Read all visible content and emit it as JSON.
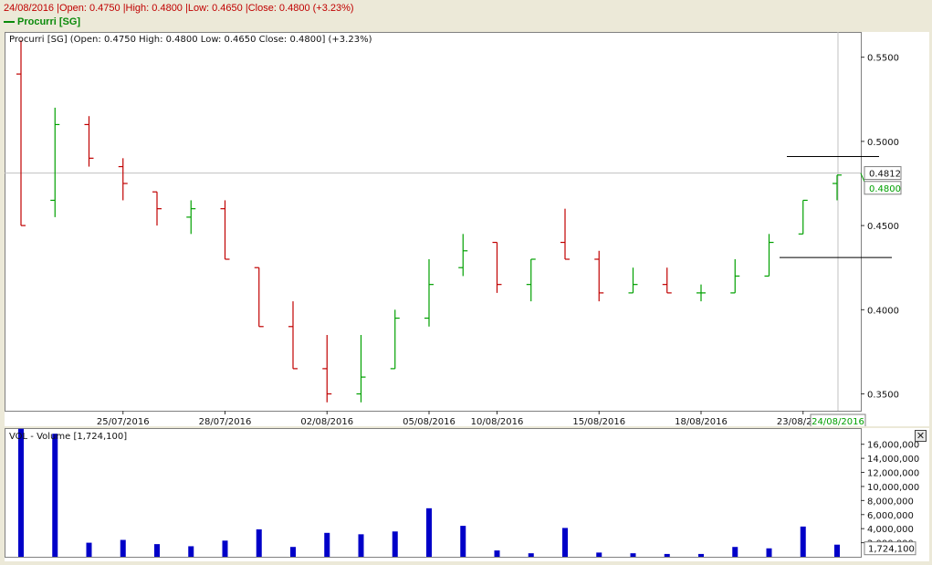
{
  "header": {
    "info_text": "24/08/2016 |Open: 0.4750 |High: 0.4800 |Low: 0.4650 |Close: 0.4800 (+3.23%)",
    "symbol_legend": "Procurri [SG]"
  },
  "price_panel": {
    "label": "Procurri [SG] (Open: 0.4750  High: 0.4800  Low: 0.4650  Close: 0.4800] (+3.23%)",
    "crosshair_price_label": "0.4812",
    "last_close_label": "0.4800",
    "crosshair_date_label": "24/08/2016"
  },
  "volume_panel": {
    "label": "VOL - Volume [1,724,100]",
    "last_volume_label": "1,724,100",
    "close_symbol": "✕"
  },
  "colors": {
    "up": "#00a000",
    "down": "#c00000",
    "volume": "#0000c8",
    "gridline": "#c0c0c0",
    "reference_line": "#000000"
  },
  "chart_data": [
    {
      "type": "ohlc",
      "title": "Procurri [SG]",
      "ylim": [
        0.34,
        0.565
      ],
      "y_ticks": [
        "0.5500",
        "0.5000",
        "0.4500",
        "0.4000",
        "0.3500"
      ],
      "x_tick_labels": [
        {
          "index": 3,
          "label": "25/07/2016"
        },
        {
          "index": 6,
          "label": "28/07/2016"
        },
        {
          "index": 9,
          "label": "02/08/2016"
        },
        {
          "index": 12,
          "label": "05/08/2016"
        },
        {
          "index": 14,
          "label": "10/08/2016"
        },
        {
          "index": 17,
          "label": "15/08/2016"
        },
        {
          "index": 20,
          "label": "18/08/2016"
        },
        {
          "index": 23,
          "label": "23/08/2016"
        }
      ],
      "bars": [
        {
          "o": 0.54,
          "h": 0.56,
          "l": 0.45,
          "c": 0.45
        },
        {
          "o": 0.465,
          "h": 0.52,
          "l": 0.455,
          "c": 0.51
        },
        {
          "o": 0.51,
          "h": 0.515,
          "l": 0.485,
          "c": 0.49
        },
        {
          "o": 0.485,
          "h": 0.49,
          "l": 0.465,
          "c": 0.475
        },
        {
          "o": 0.47,
          "h": 0.47,
          "l": 0.45,
          "c": 0.46
        },
        {
          "o": 0.455,
          "h": 0.465,
          "l": 0.445,
          "c": 0.46
        },
        {
          "o": 0.46,
          "h": 0.465,
          "l": 0.43,
          "c": 0.43
        },
        {
          "o": 0.425,
          "h": 0.425,
          "l": 0.39,
          "c": 0.39
        },
        {
          "o": 0.39,
          "h": 0.405,
          "l": 0.365,
          "c": 0.365
        },
        {
          "o": 0.365,
          "h": 0.385,
          "l": 0.345,
          "c": 0.35
        },
        {
          "o": 0.35,
          "h": 0.385,
          "l": 0.345,
          "c": 0.36
        },
        {
          "o": 0.365,
          "h": 0.4,
          "l": 0.365,
          "c": 0.395
        },
        {
          "o": 0.395,
          "h": 0.43,
          "l": 0.39,
          "c": 0.415
        },
        {
          "o": 0.425,
          "h": 0.445,
          "l": 0.42,
          "c": 0.435
        },
        {
          "o": 0.44,
          "h": 0.44,
          "l": 0.41,
          "c": 0.415
        },
        {
          "o": 0.415,
          "h": 0.43,
          "l": 0.405,
          "c": 0.43
        },
        {
          "o": 0.44,
          "h": 0.46,
          "l": 0.43,
          "c": 0.43
        },
        {
          "o": 0.43,
          "h": 0.435,
          "l": 0.405,
          "c": 0.41
        },
        {
          "o": 0.41,
          "h": 0.425,
          "l": 0.41,
          "c": 0.415
        },
        {
          "o": 0.415,
          "h": 0.425,
          "l": 0.41,
          "c": 0.41
        },
        {
          "o": 0.41,
          "h": 0.415,
          "l": 0.405,
          "c": 0.41
        },
        {
          "o": 0.41,
          "h": 0.43,
          "l": 0.41,
          "c": 0.42
        },
        {
          "o": 0.42,
          "h": 0.445,
          "l": 0.42,
          "c": 0.44
        },
        {
          "o": 0.445,
          "h": 0.465,
          "l": 0.445,
          "c": 0.465
        },
        {
          "o": 0.475,
          "h": 0.48,
          "l": 0.465,
          "c": 0.48
        }
      ],
      "crosshair_price": 0.4812,
      "reference_lines": [
        0.491,
        0.431
      ]
    },
    {
      "type": "bar",
      "title": "VOL - Volume [1,724,100]",
      "ylim": [
        0,
        18300000
      ],
      "y_ticks": [
        "16,000,000",
        "14,000,000",
        "12,000,000",
        "10,000,000",
        "8,000,000",
        "6,000,000",
        "4,000,000",
        "2,000,000"
      ],
      "values": [
        18200000,
        17500000,
        2000000,
        2400000,
        1800000,
        1500000,
        2300000,
        3900000,
        1400000,
        3400000,
        3200000,
        3600000,
        6900000,
        4400000,
        900000,
        500000,
        4100000,
        600000,
        500000,
        400000,
        400000,
        1400000,
        1200000,
        4300000,
        1724100
      ]
    }
  ]
}
